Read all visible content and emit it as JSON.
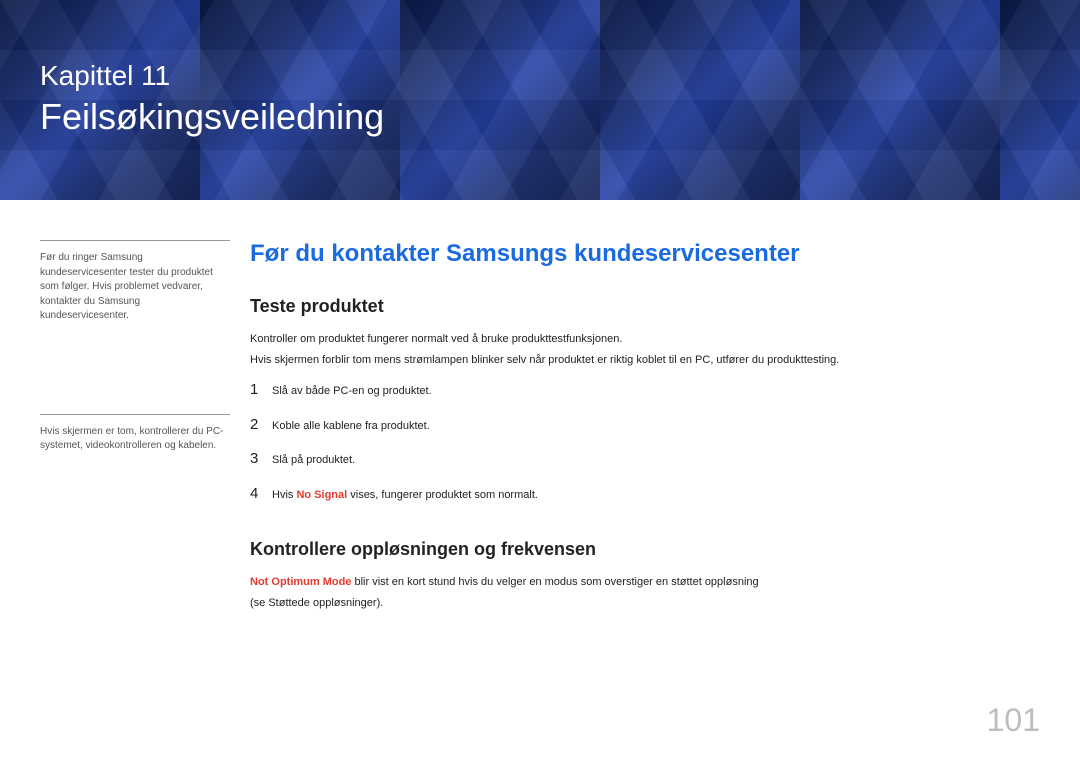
{
  "header": {
    "chapter_label": "Kapittel 11",
    "chapter_title": "Feilsøkingsveiledning"
  },
  "sidebar": {
    "note1": "Før du ringer Samsung kundeservicesenter tester du produktet som følger. Hvis problemet vedvarer, kontakter du Samsung kundeservicesenter.",
    "note2": "Hvis skjermen er tom, kontrollerer du PC-systemet, videokontrolleren og kabelen."
  },
  "main": {
    "section_title": "Før du kontakter Samsungs kundeservicesenter",
    "test_product": {
      "title": "Teste produktet",
      "p1": "Kontroller om produktet fungerer normalt ved å bruke produkttestfunksjonen.",
      "p2": "Hvis skjermen forblir tom mens strømlampen blinker selv når produktet er riktig koblet til en PC, utfører du produkttesting.",
      "steps": [
        {
          "num": "1",
          "text": "Slå av både PC-en og produktet."
        },
        {
          "num": "2",
          "text": "Koble alle kablene fra produktet."
        },
        {
          "num": "3",
          "text": "Slå på produktet."
        },
        {
          "num": "4",
          "prefix": "Hvis ",
          "bold": "No Signal",
          "suffix": " vises, fungerer produktet som normalt."
        }
      ]
    },
    "resolution": {
      "title": "Kontrollere oppløsningen og frekvensen",
      "bold_prefix": "Not Optimum Mode",
      "rest": " blir vist en kort stund hvis du velger en modus som overstiger en støttet oppløsning",
      "p2": "(se Støttede oppløsninger)."
    }
  },
  "page_number": "101"
}
